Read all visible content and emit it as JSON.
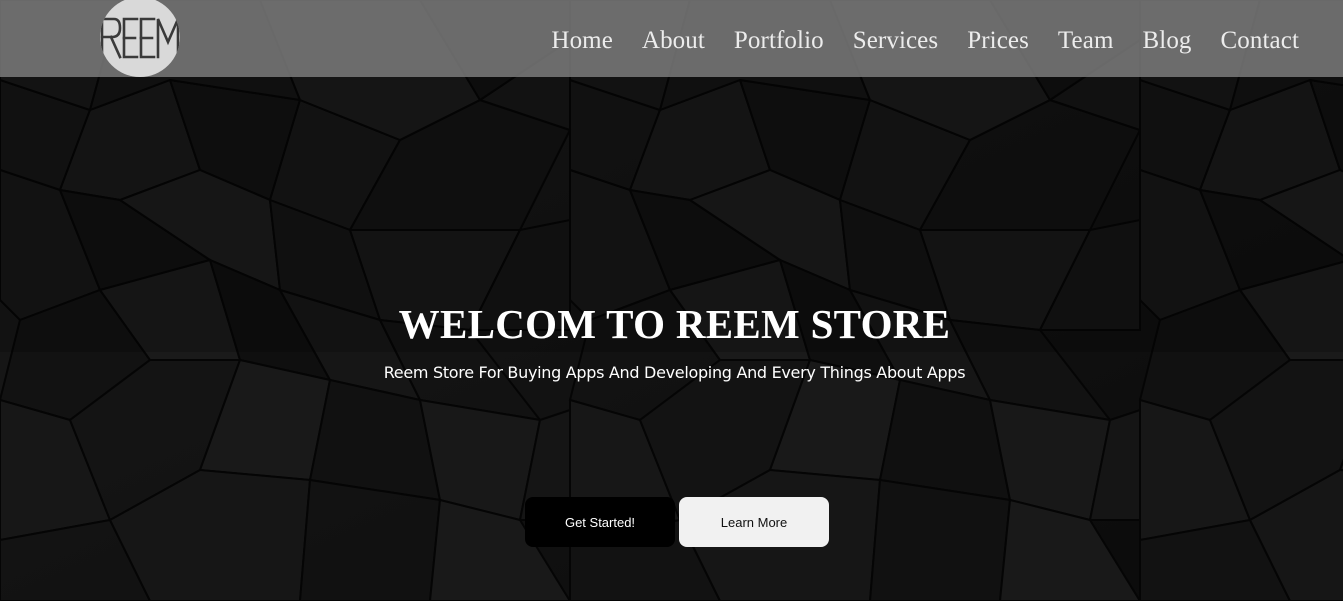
{
  "brand": {
    "logo_text": "REEM"
  },
  "nav": {
    "items": [
      "Home",
      "About",
      "Portfolio",
      "Services",
      "Prices",
      "Team",
      "Blog",
      "Contact"
    ]
  },
  "hero": {
    "title": "WELCOM TO REEM STORE",
    "subtitle": "Reem Store For Buying Apps And Developing And Every Things About Apps",
    "primary_button": "Get Started!",
    "secondary_button": "Learn More"
  },
  "colors": {
    "navbar_bg": "#808080",
    "nav_text": "#ececec",
    "hero_bg": "#111111",
    "primary_button_bg": "#000000",
    "secondary_button_bg": "#f1f1f1"
  }
}
